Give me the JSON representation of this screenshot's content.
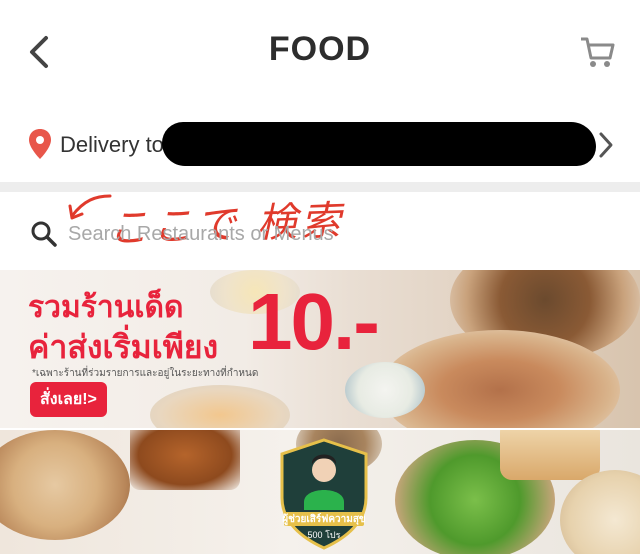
{
  "header": {
    "title": "FOOD",
    "back_icon": "chevron-left-icon",
    "cart_icon": "cart-icon"
  },
  "delivery": {
    "label": "Delivery to",
    "address": "",
    "pin_icon": "location-pin-icon",
    "pin_color": "#e8564a"
  },
  "search": {
    "placeholder": "Search Restaurants or Menus",
    "value": ""
  },
  "annotation": {
    "text": "ここで 検索",
    "color": "#e03a2c"
  },
  "promo_banner": {
    "line1": "รวมร้านเด็ด",
    "line2": "ค่าส่งเริ่มเพียง",
    "price": "10.-",
    "note": "*เฉพาะร้านที่ร่วมรายการและอยู่ในระยะทางที่กำหนด",
    "cta": "สั่งเลย!>",
    "accent": "#e8233c"
  },
  "second_banner": {
    "badge_title": "ผู้ช่วยเสิร์ฟความสุข",
    "badge_sub": "500 โปร"
  }
}
